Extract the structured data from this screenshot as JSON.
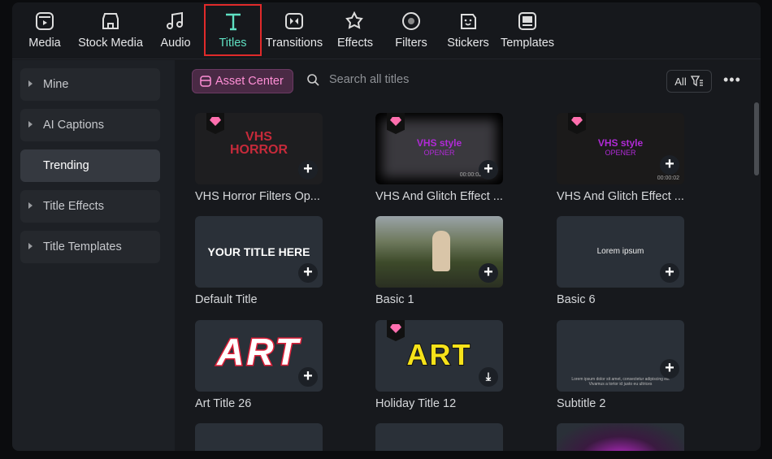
{
  "tabs": [
    {
      "label": "Media",
      "icon": "media-icon"
    },
    {
      "label": "Stock Media",
      "icon": "store-icon"
    },
    {
      "label": "Audio",
      "icon": "music-icon"
    },
    {
      "label": "Titles",
      "icon": "text-icon"
    },
    {
      "label": "Transitions",
      "icon": "transition-icon"
    },
    {
      "label": "Effects",
      "icon": "star-icon"
    },
    {
      "label": "Filters",
      "icon": "filter-icon"
    },
    {
      "label": "Stickers",
      "icon": "sticker-icon"
    },
    {
      "label": "Templates",
      "icon": "template-icon"
    }
  ],
  "sidebar": {
    "items": [
      {
        "label": "Mine"
      },
      {
        "label": "AI Captions"
      },
      {
        "label": "Trending"
      },
      {
        "label": "Title Effects"
      },
      {
        "label": "Title Templates"
      }
    ]
  },
  "toolbar": {
    "asset_center": "Asset Center",
    "search_placeholder": "Search all titles",
    "filter_label": "All"
  },
  "cards": [
    {
      "label": "VHS Horror Filters Op...",
      "t1": "VHS",
      "t2": "HORROR"
    },
    {
      "label": "VHS And Glitch Effect ...",
      "t1": "VHS style",
      "t2": "OPENER",
      "tc": "00:00:02"
    },
    {
      "label": "VHS And Glitch Effect ...",
      "t1": "VHS style",
      "t2": "OPENER",
      "tc": "00:00:02"
    },
    {
      "label": "Default Title",
      "t1": "YOUR TITLE HERE"
    },
    {
      "label": "Basic 1"
    },
    {
      "label": "Basic 6",
      "t1": "Lorem ipsum"
    },
    {
      "label": "Art Title 26",
      "t1": "ART"
    },
    {
      "label": "Holiday Title 12",
      "t1": "ART"
    },
    {
      "label": "Subtitle 2",
      "t1": "Lorem ipsum dolor sit amet, consectetur adipiscing elit",
      "t2": "Vivamus a tortor id justo eu ultrices"
    }
  ],
  "colors": {
    "accent": "#5fe0c2",
    "asset": "#ff8fd6",
    "highlight": "#e02a2a"
  }
}
